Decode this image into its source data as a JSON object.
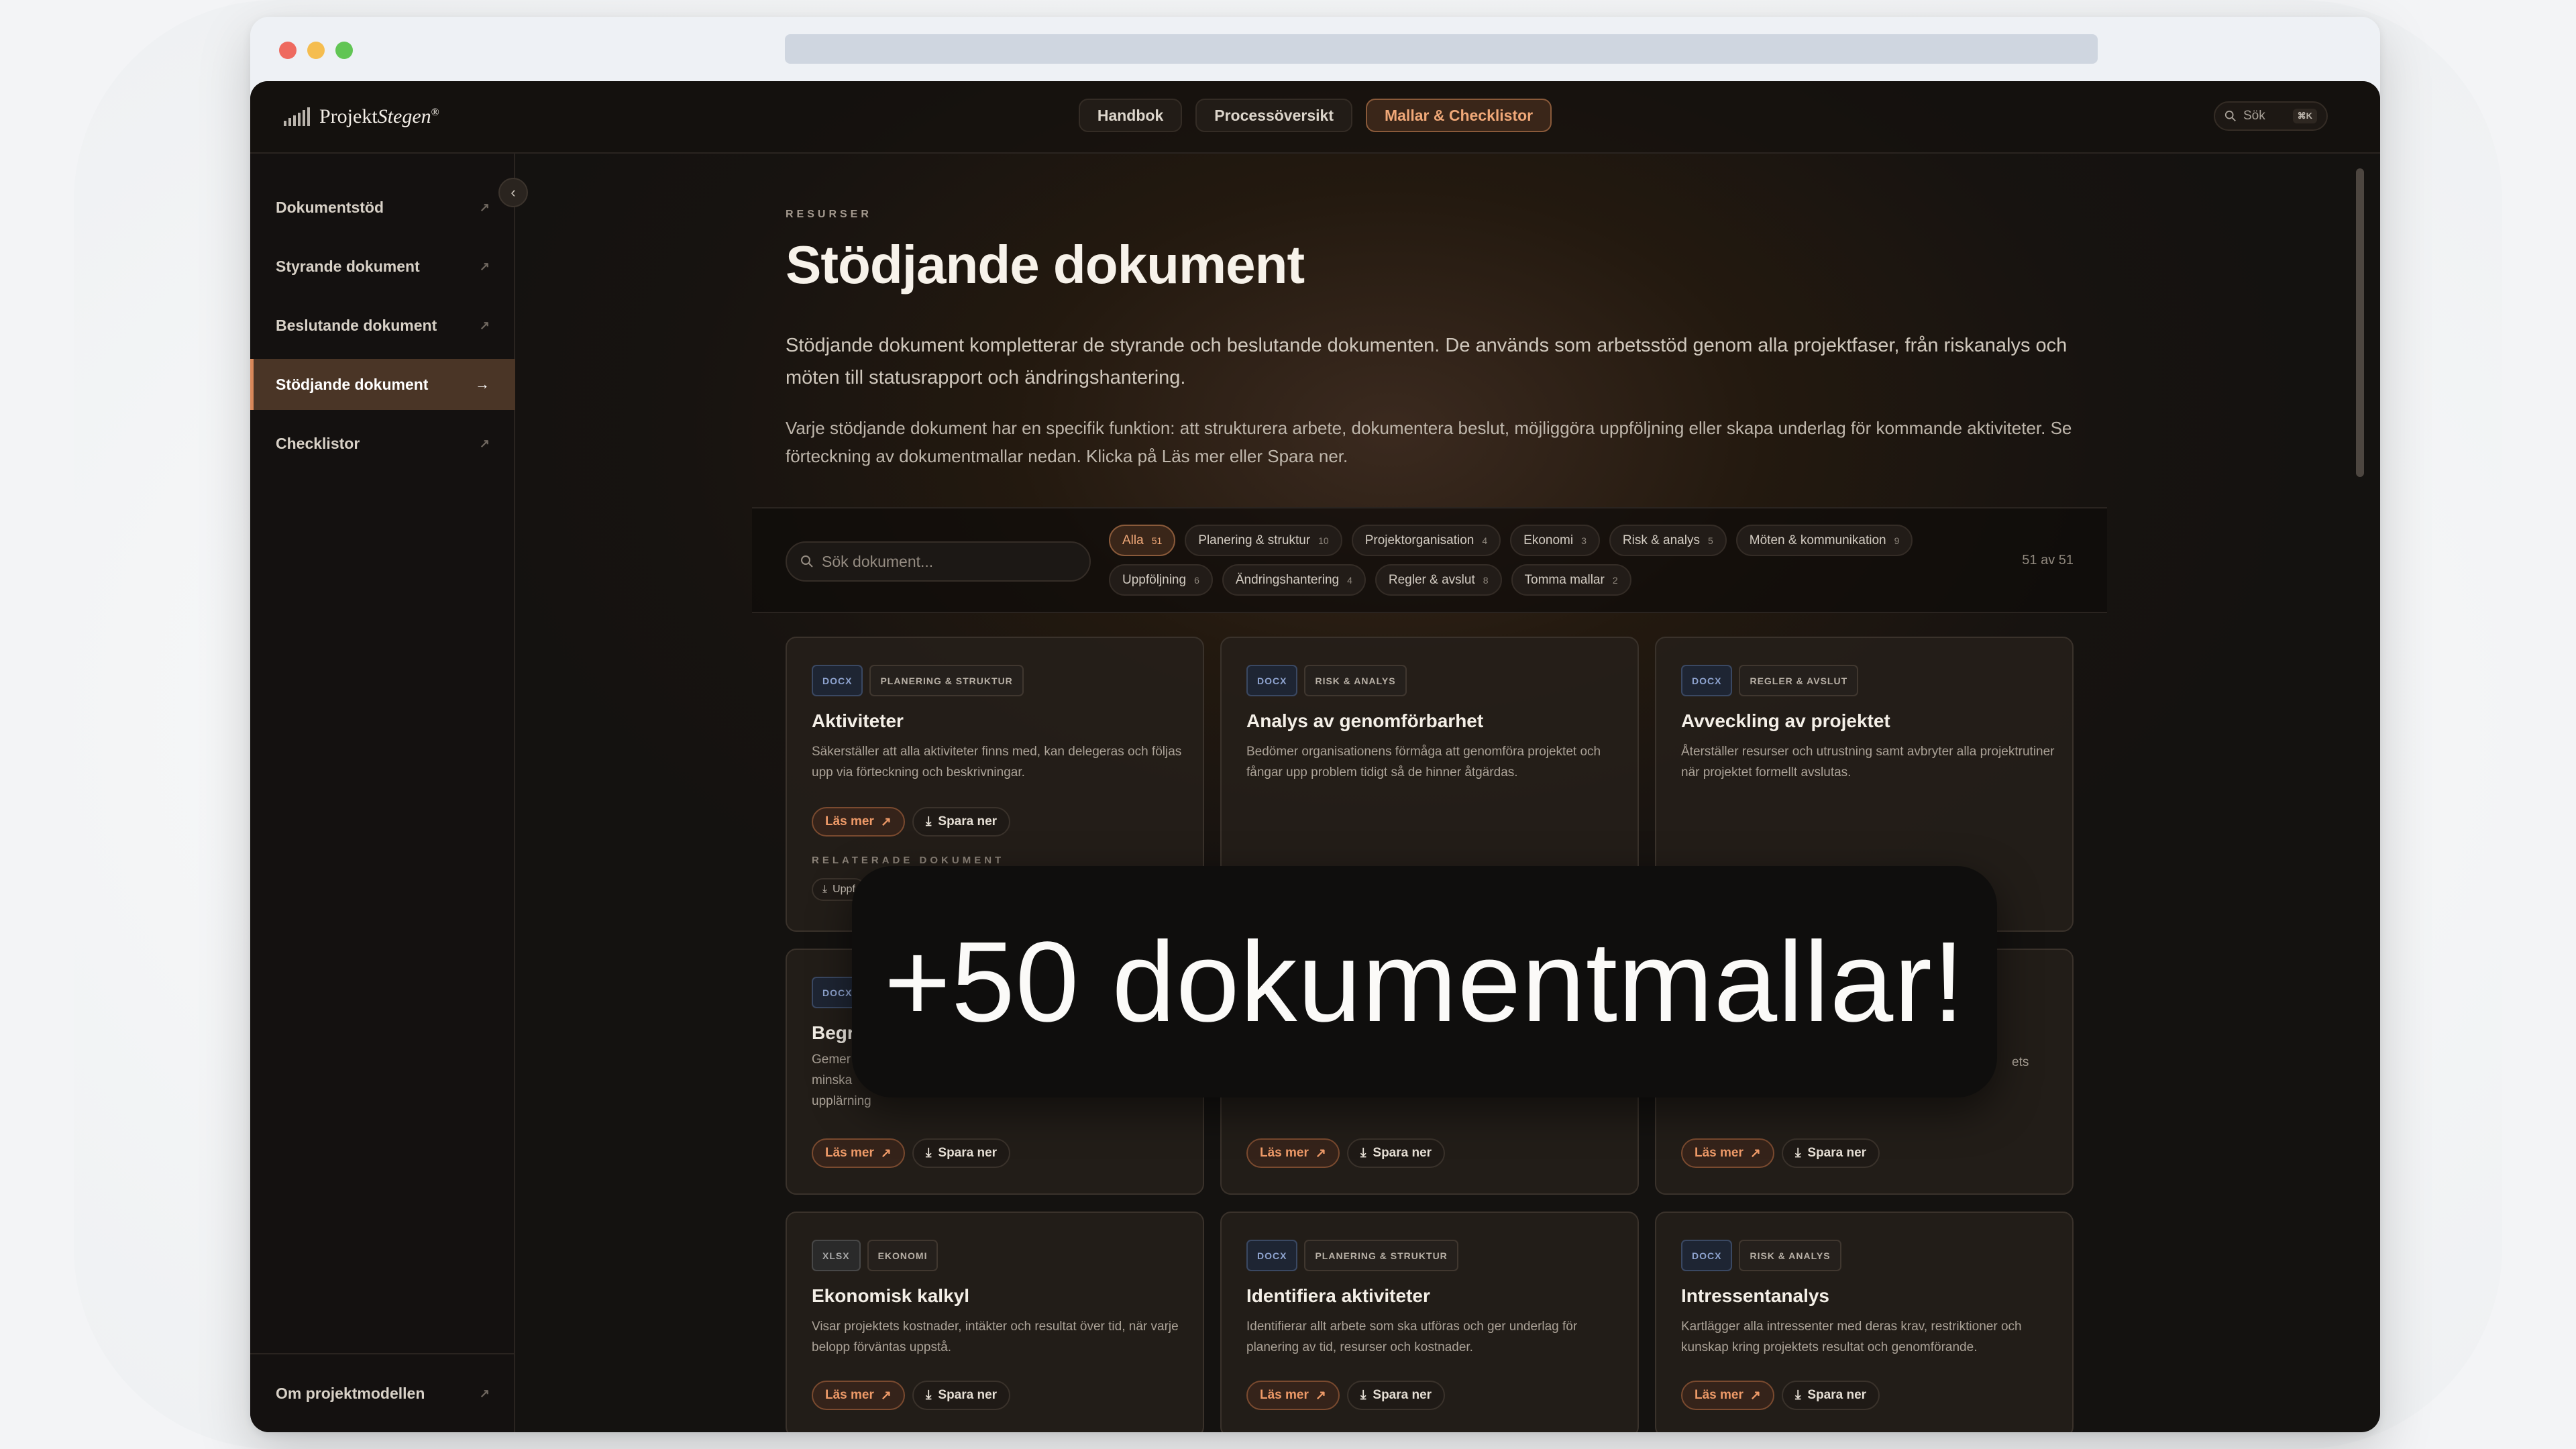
{
  "brand": {
    "name_a": "Projekt",
    "name_b": "Stegen",
    "reg": "®"
  },
  "nav": [
    {
      "label": "Handbok",
      "active": false
    },
    {
      "label": "Processöversikt",
      "active": false
    },
    {
      "label": "Mallar & Checklistor",
      "active": true
    }
  ],
  "search_top": {
    "label": "Sök",
    "shortcut": "⌘K"
  },
  "sidebar": {
    "items": [
      {
        "label": "Dokumentstöd",
        "active": false
      },
      {
        "label": "Styrande dokument",
        "active": false
      },
      {
        "label": "Beslutande dokument",
        "active": false
      },
      {
        "label": "Stödjande dokument",
        "active": true
      },
      {
        "label": "Checklistor",
        "active": false
      }
    ],
    "bottom": "Om projektmodellen"
  },
  "page": {
    "eyebrow": "RESURSER",
    "title": "Stödjande dokument",
    "lead": "Stödjande dokument kompletterar de styrande och beslutande dokumenten. De används som arbetsstöd genom alla projektfaser, från riskanalys och möten till statusrapport och ändringshantering.",
    "lead2": "Varje stödjande dokument har en specifik funktion: att strukturera arbete, dokumentera beslut, möjliggöra uppföljning eller skapa underlag för kommande aktiviteter. Se förteckning av dokumentmallar nedan. Klicka på Läs mer eller Spara ner."
  },
  "filters": {
    "search_placeholder": "Sök dokument...",
    "count": "51 av 51",
    "chips": [
      {
        "label": "Alla",
        "n": "51",
        "active": true
      },
      {
        "label": "Planering & struktur",
        "n": "10"
      },
      {
        "label": "Projektorganisation",
        "n": "4"
      },
      {
        "label": "Ekonomi",
        "n": "3"
      },
      {
        "label": "Risk & analys",
        "n": "5"
      },
      {
        "label": "Möten & kommunikation",
        "n": "9"
      },
      {
        "label": "Uppföljning",
        "n": "6"
      },
      {
        "label": "Ändringshantering",
        "n": "4"
      },
      {
        "label": "Regler & avslut",
        "n": "8"
      },
      {
        "label": "Tomma mallar",
        "n": "2"
      }
    ]
  },
  "buttons": {
    "read": "Läs mer",
    "save": "Spara ner"
  },
  "cards": [
    {
      "fmt": "DOCX",
      "cat": "PLANERING & STRUKTUR",
      "title": "Aktiviteter",
      "desc": "Säkerställer att alla aktiviteter finns med, kan delegeras och följas upp via förteckning och beskrivningar.",
      "related_label": "RELATERADE DOKUMENT",
      "related": "Uppf"
    },
    {
      "fmt": "DOCX",
      "cat": "RISK & ANALYS",
      "title": "Analys av genomförbarhet",
      "desc": "Bedömer organisationens förmåga att genomföra projektet och fångar upp problem tidigt så de hinner åtgärdas."
    },
    {
      "fmt": "DOCX",
      "cat": "REGLER & AVSLUT",
      "title": "Avveckling av projektet",
      "desc": "Återställer resurser och utrustning samt avbryter alla projektrutiner när projektet formellt avslutas."
    },
    {
      "fmt": "DOCX",
      "title": "Begr",
      "desc_lines": [
        "Gemer",
        "minska",
        "upplärning"
      ]
    },
    {
      "desc_tail": "ets"
    },
    {
      "fmt": "XLSX",
      "cat": "EKONOMI",
      "title": "Ekonomisk kalkyl",
      "desc": "Visar projektets kostnader, intäkter och resultat över tid, när varje belopp förväntas uppstå."
    },
    {
      "fmt": "DOCX",
      "cat": "PLANERING & STRUKTUR",
      "title": "Identifiera aktiviteter",
      "desc": "Identifierar allt arbete som ska utföras och ger underlag för planering av tid, resurser och kostnader."
    },
    {
      "fmt": "DOCX",
      "cat": "RISK & ANALYS",
      "title": "Intressentanalys",
      "desc": "Kartlägger alla intressenter med deras krav, restriktioner och kunskap kring projektets resultat och genomförande."
    }
  ],
  "overlay": "+50 dokumentmallar!",
  "icons": {
    "read": "arrow-up-right-icon",
    "save": "download-icon",
    "search": "search-icon",
    "collapse": "chevron-left-icon"
  }
}
